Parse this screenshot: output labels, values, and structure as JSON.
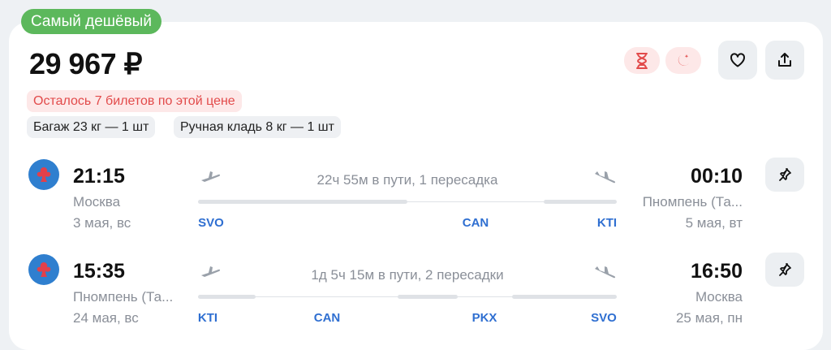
{
  "badge": "Самый дешёвый",
  "price": "29 967 ₽",
  "seats_warning": "Осталось 7 билетов по этой цене",
  "baggage": [
    "Багаж 23 кг — 1 шт",
    "Ручная кладь 8 кг — 1 шт"
  ],
  "chips": [
    {
      "icon": "hourglass-icon",
      "color": "#e24a4a"
    },
    {
      "icon": "moon-icon",
      "color": "#e24a4a"
    }
  ],
  "actions": {
    "favorite_icon": "heart-icon",
    "share_icon": "share-icon"
  },
  "colors": {
    "accent": "#2f6fd1",
    "badge": "#5cb85c",
    "warning": "#e24a4a"
  },
  "flights": [
    {
      "dep_time": "21:15",
      "dep_city": "Москва",
      "dep_date": "3 мая, вс",
      "arr_time": "00:10",
      "arr_city": "Пномпень (Та...",
      "arr_date": "5 мая, вт",
      "duration": "22ч 55м в пути, 1 пересадка",
      "airports": [
        "SVO",
        "CAN",
        "KTI"
      ]
    },
    {
      "dep_time": "15:35",
      "dep_city": "Пномпень (Та...",
      "dep_date": "24 мая, вс",
      "arr_time": "16:50",
      "arr_city": "Москва",
      "arr_date": "25 мая, пн",
      "duration": "1д 5ч 15м в пути, 2 пересадки",
      "airports": [
        "KTI",
        "CAN",
        "PKX",
        "SVO"
      ]
    }
  ]
}
